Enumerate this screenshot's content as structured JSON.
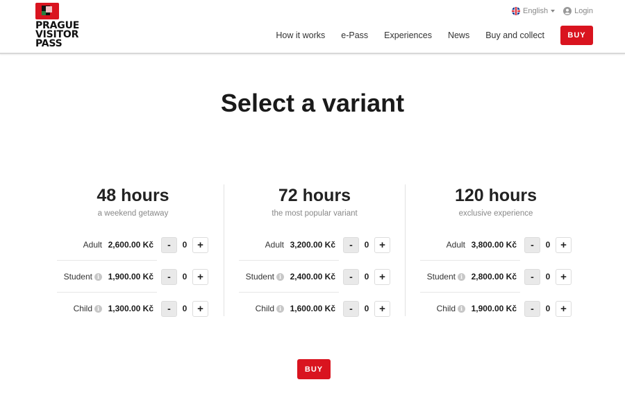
{
  "header": {
    "logo_lines": [
      "PRAGUE",
      "VISITOR",
      "PASS"
    ],
    "language": "English",
    "login": "Login",
    "nav": [
      "How it works",
      "e-Pass",
      "Experiences",
      "News",
      "Buy and collect"
    ],
    "buy_label": "BUY"
  },
  "title": "Select a variant",
  "variants": [
    {
      "title": "48 hours",
      "subtitle": "a weekend getaway",
      "rows": [
        {
          "label": "Adult",
          "price": "2,600.00 Kč",
          "qty": "0"
        },
        {
          "label": "Student",
          "price": "1,900.00 Kč",
          "qty": "0"
        },
        {
          "label": "Child",
          "price": "1,300.00 Kč",
          "qty": "0"
        }
      ]
    },
    {
      "title": "72 hours",
      "subtitle": "the most popular variant",
      "rows": [
        {
          "label": "Adult",
          "price": "3,200.00 Kč",
          "qty": "0"
        },
        {
          "label": "Student",
          "price": "2,400.00 Kč",
          "qty": "0"
        },
        {
          "label": "Child",
          "price": "1,600.00 Kč",
          "qty": "0"
        }
      ]
    },
    {
      "title": "120 hours",
      "subtitle": "exclusive experience",
      "rows": [
        {
          "label": "Adult",
          "price": "3,800.00 Kč",
          "qty": "0"
        },
        {
          "label": "Student",
          "price": "2,800.00 Kč",
          "qty": "0"
        },
        {
          "label": "Child",
          "price": "1,900.00 Kč",
          "qty": "0"
        }
      ]
    }
  ],
  "stepper": {
    "minus": "-",
    "plus": "+"
  },
  "info_glyph": "i",
  "buy_bottom_label": "BUY",
  "colors": {
    "brand": "#d9141f"
  }
}
